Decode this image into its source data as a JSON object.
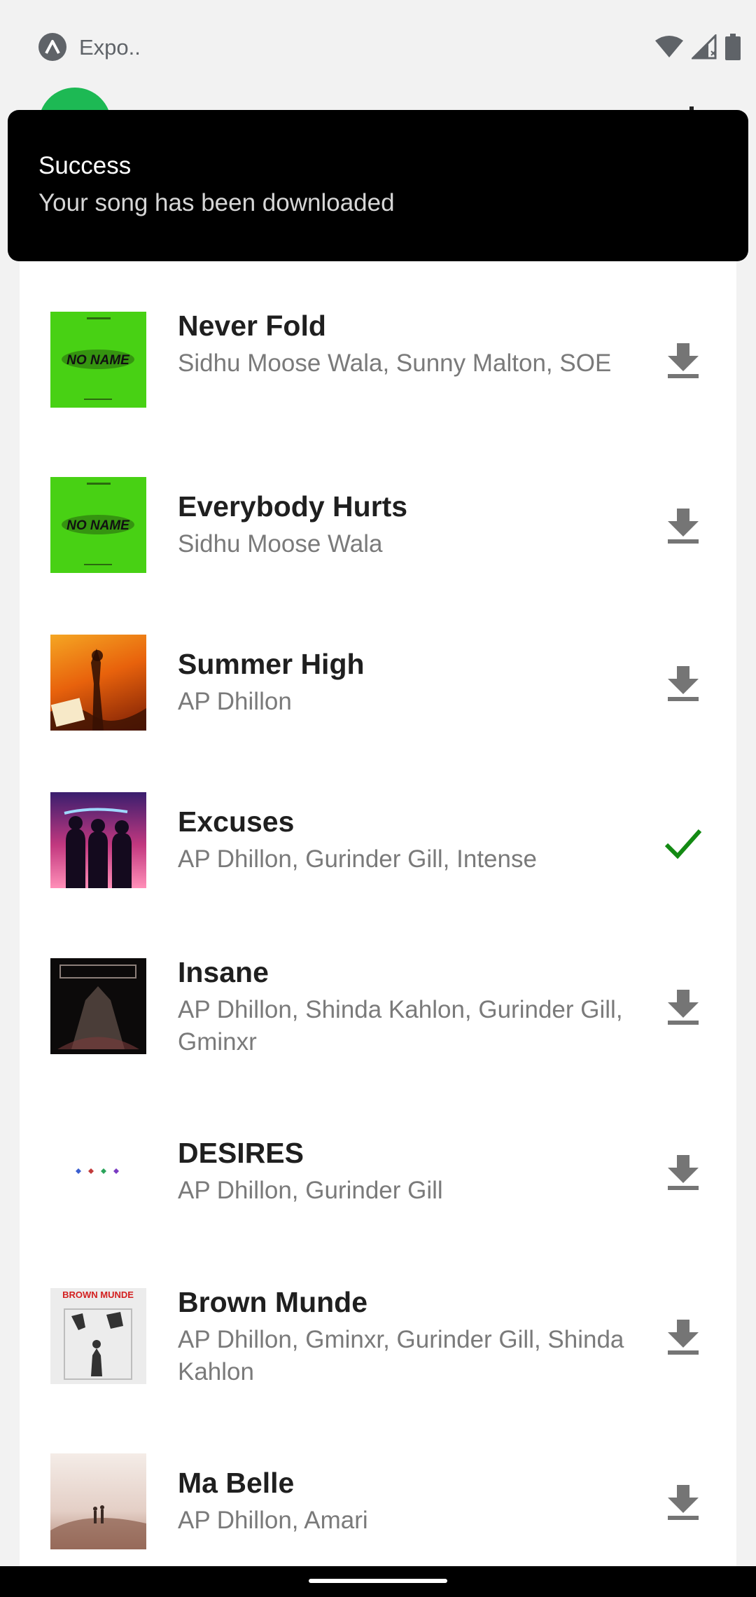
{
  "status_bar": {
    "app_label": "Expo..",
    "icons": [
      "expo-icon",
      "wifi-icon",
      "signal-icon",
      "battery-icon"
    ]
  },
  "toast": {
    "title": "Success",
    "message": "Your song has been downloaded"
  },
  "songs": [
    {
      "title": "Never Fold",
      "artists": "Sidhu Moose Wala, Sunny Malton, SOE",
      "cover_text": "NO NAME",
      "status": "download"
    },
    {
      "title": "Everybody Hurts",
      "artists": "Sidhu Moose Wala",
      "cover_text": "NO NAME",
      "status": "download"
    },
    {
      "title": "Summer High",
      "artists": "AP Dhillon",
      "status": "download"
    },
    {
      "title": "Excuses",
      "artists": "AP Dhillon, Gurinder Gill, Intense",
      "status": "downloaded"
    },
    {
      "title": "Insane",
      "artists": "AP Dhillon, Shinda Kahlon, Gurinder Gill, Gminxr",
      "status": "download"
    },
    {
      "title": "DESIRES",
      "artists": "AP Dhillon, Gurinder Gill",
      "status": "download"
    },
    {
      "title": "Brown Munde",
      "artists": "AP Dhillon, Gminxr, Gurinder Gill, Shinda Kahlon",
      "cover_text": "BROWN MUNDE",
      "status": "download"
    },
    {
      "title": "Ma Belle",
      "artists": "AP Dhillon, Amari",
      "status": "download"
    }
  ],
  "colors": {
    "accent": "#1DB954",
    "downloaded_check": "#138a13",
    "download_icon": "#757575"
  }
}
